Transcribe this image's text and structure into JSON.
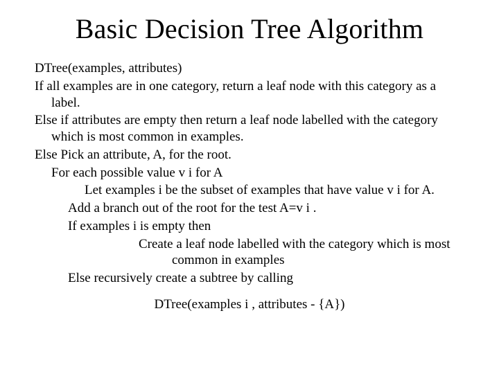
{
  "title": "Basic Decision Tree Algorithm",
  "lines": {
    "sig": "DTree(examples, attributes)",
    "c1": "If all examples are in one category, return a leaf node with this category as a label.",
    "c2": "Else if attributes are empty then return a leaf node labelled with the category which is most common in examples.",
    "c3": "Else Pick an attribute, A, for the root.",
    "c4": "For each possible value v i for A",
    "c5": "Let examples i be the subset of examples that have value v i for A.",
    "c6": "Add a branch out of the root for the test A=v i .",
    "c7": "If examples i is empty then",
    "c8": "Create a leaf node labelled with the category which is most common in examples",
    "c9": "Else recursively create a subtree by calling",
    "c10": "DTree(examples i , attributes - {A})"
  }
}
